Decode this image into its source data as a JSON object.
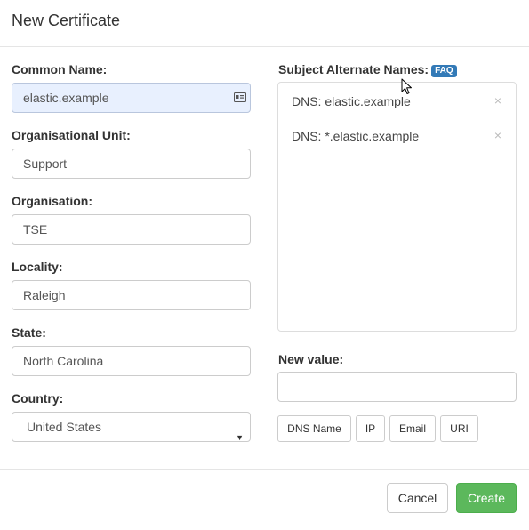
{
  "modal": {
    "title": "New Certificate"
  },
  "form": {
    "common_name": {
      "label": "Common Name:",
      "value": "elastic.example"
    },
    "org_unit": {
      "label": "Organisational Unit:",
      "value": "Support"
    },
    "organisation": {
      "label": "Organisation:",
      "value": "TSE"
    },
    "locality": {
      "label": "Locality:",
      "value": "Raleigh"
    },
    "state": {
      "label": "State:",
      "value": "North Carolina"
    },
    "country": {
      "label": "Country:",
      "value": "United States"
    }
  },
  "san": {
    "label": "Subject Alternate Names:",
    "faq": "FAQ",
    "items": [
      {
        "text": "DNS: elastic.example",
        "remove": "×"
      },
      {
        "text": "DNS: *.elastic.example",
        "remove": "×"
      }
    ],
    "new_value_label": "New value:",
    "new_value": "",
    "buttons": [
      "DNS Name",
      "IP",
      "Email",
      "URI"
    ]
  },
  "footer": {
    "cancel": "Cancel",
    "create": "Create"
  },
  "colors": {
    "primary": "#337ab7",
    "success": "#5cb85c",
    "autofill": "#e8f0fe"
  }
}
